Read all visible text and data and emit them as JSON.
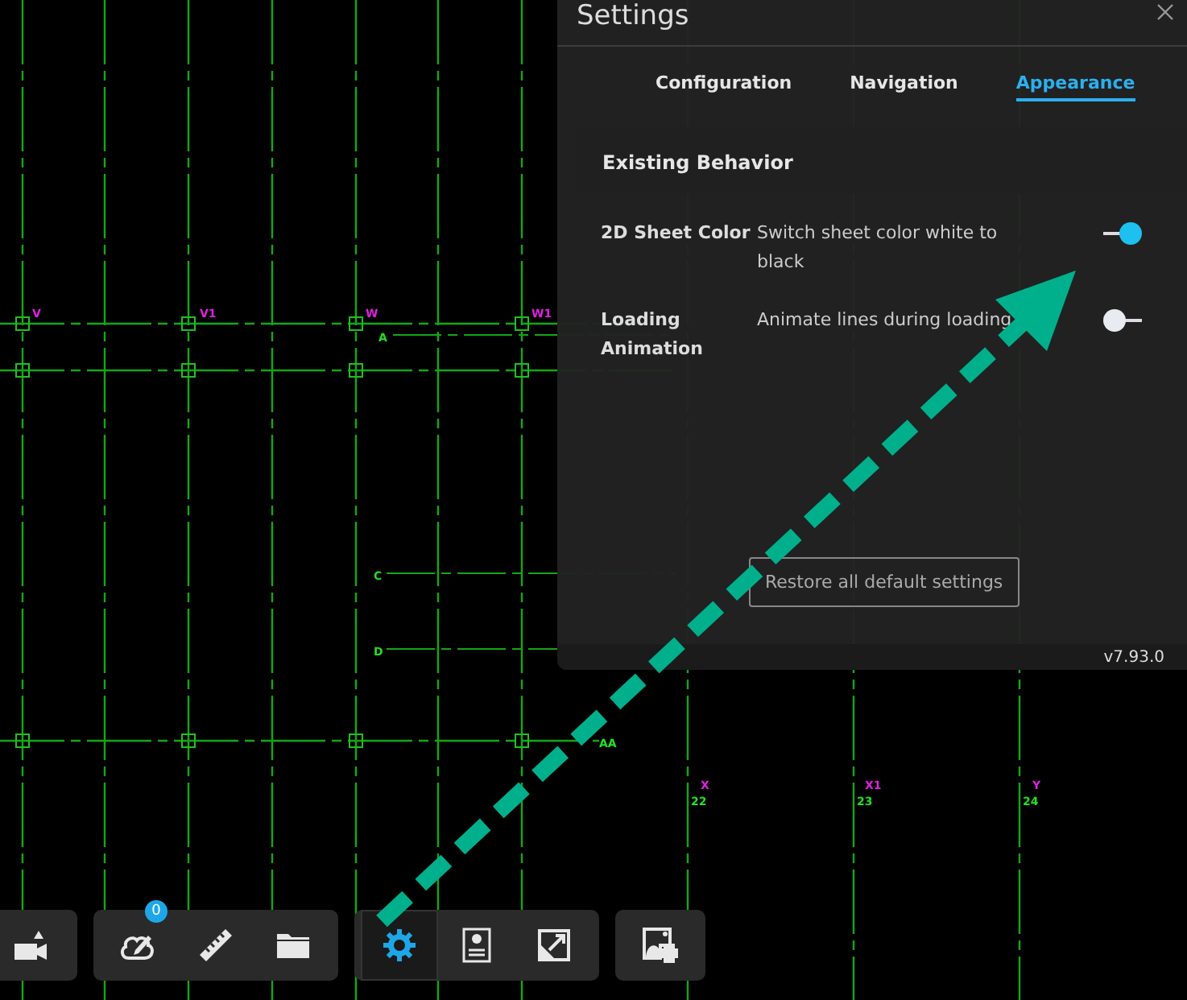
{
  "drawing": {
    "labels": [
      {
        "text": "V",
        "color": "#e020e0"
      },
      {
        "text": "V1",
        "color": "#e020e0"
      },
      {
        "text": "W",
        "color": "#e020e0"
      },
      {
        "text": "W1",
        "color": "#e020e0"
      },
      {
        "text": "A",
        "color": "#20e020"
      },
      {
        "text": "C",
        "color": "#20e020"
      },
      {
        "text": "D",
        "color": "#20e020"
      },
      {
        "text": "AA",
        "color": "#20e020"
      },
      {
        "text": "X",
        "color": "#e020e0"
      },
      {
        "text": "X1",
        "color": "#e020e0"
      },
      {
        "text": "Y",
        "color": "#e020e0"
      },
      {
        "text": "22",
        "color": "#20e020"
      },
      {
        "text": "23",
        "color": "#20e020"
      },
      {
        "text": "24",
        "color": "#20e020"
      }
    ]
  },
  "settings": {
    "title": "Settings",
    "tabs": [
      {
        "label": "Configuration",
        "selected": false
      },
      {
        "label": "Navigation",
        "selected": false
      },
      {
        "label": "Appearance",
        "selected": true
      }
    ],
    "section": "Existing Behavior",
    "rows": [
      {
        "label": "2D Sheet Color",
        "description": "Switch sheet color white to black",
        "on": true
      },
      {
        "label": "Loading Animation",
        "description": "Animate lines during loading",
        "on": false
      }
    ],
    "restore_button": "Restore all default settings",
    "version": "v7.93.0"
  },
  "toolbar": {
    "groups": [
      [
        {
          "kind": "camera",
          "selected": false
        }
      ],
      [
        {
          "kind": "markup",
          "selected": false,
          "badge": "0"
        },
        {
          "kind": "ruler",
          "selected": false
        },
        {
          "kind": "folder",
          "selected": false
        }
      ],
      [
        {
          "kind": "settings",
          "selected": true
        },
        {
          "kind": "properties",
          "selected": false
        },
        {
          "kind": "fullscreen",
          "selected": false
        }
      ],
      [
        {
          "kind": "print",
          "selected": false
        }
      ]
    ]
  }
}
